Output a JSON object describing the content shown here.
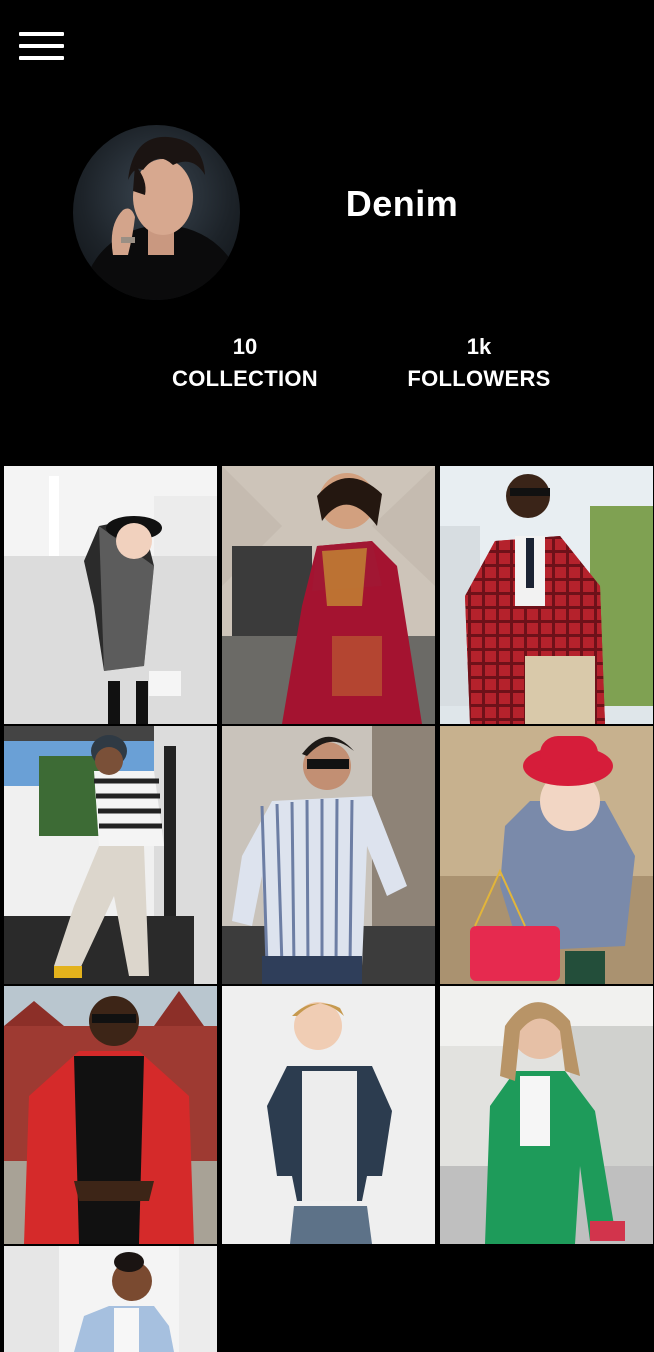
{
  "header": {
    "menu_icon": "hamburger-menu-icon"
  },
  "profile": {
    "name": "Denim",
    "avatar_icon": "profile-avatar-man-on-phone"
  },
  "stats": {
    "collection": {
      "value": "10",
      "label": "COLLECTION"
    },
    "followers": {
      "value": "1k",
      "label": "FOLLOWERS"
    }
  },
  "colors": {
    "background": "#000000",
    "text": "#ffffff"
  },
  "gallery": {
    "items": [
      {
        "subject": "girl in houndstooth jacket and black hat"
      },
      {
        "subject": "woman in red embroidered lehenga"
      },
      {
        "subject": "man in red plaid blazer"
      },
      {
        "subject": "man in striped sweater and beanie"
      },
      {
        "subject": "man in blue striped shirt and sunglasses"
      },
      {
        "subject": "toddler in red hat and blue coat with red purse"
      },
      {
        "subject": "man in red tuxedo jacket"
      },
      {
        "subject": "boy in denim jacket"
      },
      {
        "subject": "woman in green coat"
      },
      {
        "subject": "woman in light blue blazer"
      }
    ]
  }
}
